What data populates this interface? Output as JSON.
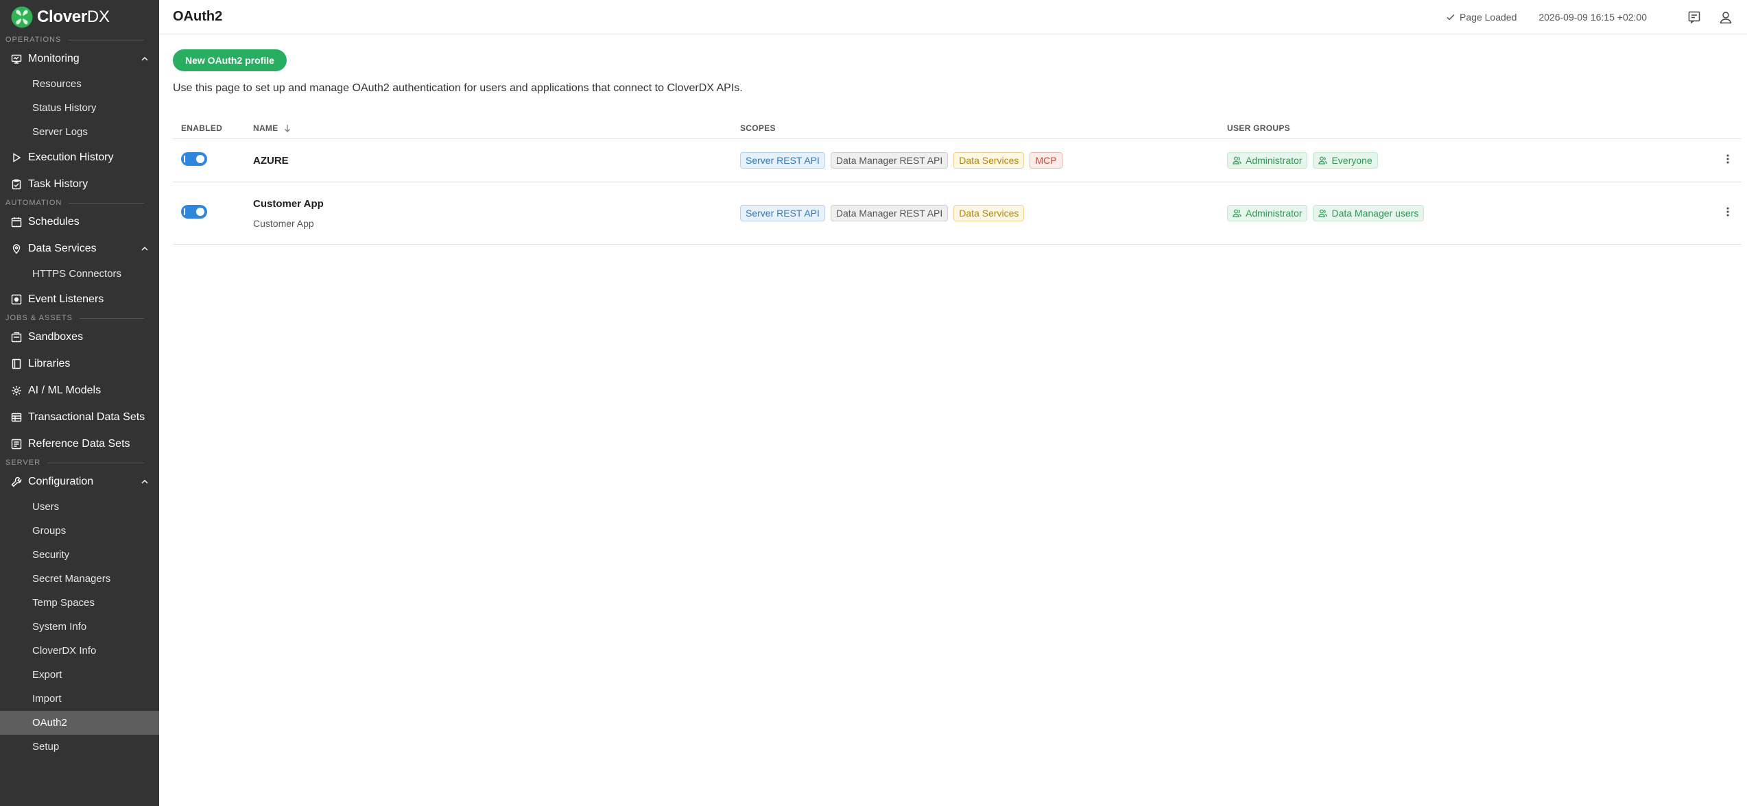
{
  "app": {
    "brand": "CloverDX",
    "brand_bold": "Clover",
    "brand_light": "DX"
  },
  "sidebar": {
    "sections": {
      "operations": "OPERATIONS",
      "automation": "AUTOMATION",
      "jobs_assets": "JOBS & ASSETS",
      "server": "SERVER"
    },
    "monitoring": {
      "label": "Monitoring",
      "items": [
        "Resources",
        "Status History",
        "Server Logs"
      ]
    },
    "execution_history": "Execution History",
    "task_history": "Task History",
    "schedules": "Schedules",
    "data_services": {
      "label": "Data Services",
      "items": [
        "HTTPS Connectors"
      ]
    },
    "event_listeners": "Event Listeners",
    "sandboxes": "Sandboxes",
    "libraries": "Libraries",
    "ai_ml_models": "AI / ML Models",
    "transactional_data_sets": "Transactional Data Sets",
    "reference_data_sets": "Reference Data Sets",
    "configuration": {
      "label": "Configuration",
      "items": [
        "Users",
        "Groups",
        "Security",
        "Secret Managers",
        "Temp Spaces",
        "System Info",
        "CloverDX Info",
        "Export",
        "Import",
        "OAuth2",
        "Setup"
      ],
      "active_item": "OAuth2"
    }
  },
  "header": {
    "title": "OAuth2",
    "status": "Page Loaded",
    "datetime": "2026-09-09 16:15 +02:00"
  },
  "main": {
    "new_button": "New OAuth2 profile",
    "description": "Use this page to set up and manage OAuth2 authentication for users and applications that connect to CloverDX APIs.",
    "columns": {
      "enabled": "ENABLED",
      "name": "NAME",
      "scopes": "SCOPES",
      "user_groups": "USER GROUPS"
    },
    "rows": [
      {
        "enabled": true,
        "name": "AZURE",
        "subtitle": "",
        "scopes": [
          {
            "label": "Server REST API",
            "color": "blue"
          },
          {
            "label": "Data Manager REST API",
            "color": "gray"
          },
          {
            "label": "Data Services",
            "color": "yellow"
          },
          {
            "label": "MCP",
            "color": "red"
          }
        ],
        "user_groups": [
          "Administrator",
          "Everyone"
        ]
      },
      {
        "enabled": true,
        "name": "Customer App",
        "subtitle": "Customer App",
        "scopes": [
          {
            "label": "Server REST API",
            "color": "blue"
          },
          {
            "label": "Data Manager REST API",
            "color": "gray"
          },
          {
            "label": "Data Services",
            "color": "yellow"
          }
        ],
        "user_groups": [
          "Administrator",
          "Data Manager users"
        ]
      }
    ]
  },
  "colors": {
    "sidebar_bg": "#333333",
    "accent_green": "#27ae60",
    "toggle_blue": "#2f86de",
    "active_item_bg": "#5e5e5e"
  }
}
